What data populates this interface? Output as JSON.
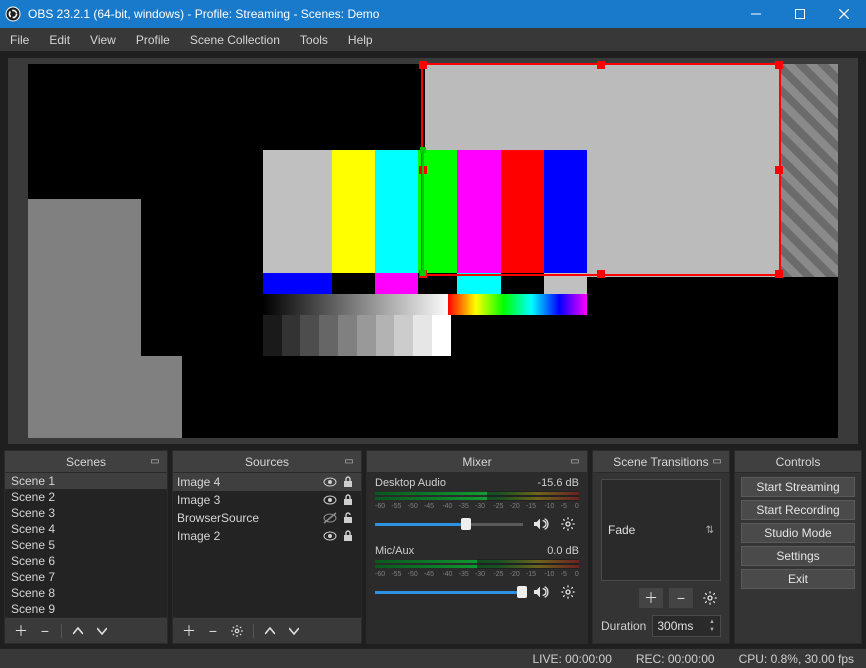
{
  "window": {
    "title": "OBS 23.2.1 (64-bit, windows) - Profile: Streaming - Scenes: Demo"
  },
  "menu": [
    "File",
    "Edit",
    "View",
    "Profile",
    "Scene Collection",
    "Tools",
    "Help"
  ],
  "scenes": {
    "title": "Scenes",
    "items": [
      "Scene 1",
      "Scene 2",
      "Scene 3",
      "Scene 4",
      "Scene 5",
      "Scene 6",
      "Scene 7",
      "Scene 8",
      "Scene 9"
    ],
    "selected": 0
  },
  "sources": {
    "title": "Sources",
    "items": [
      {
        "label": "Image 4",
        "visible": true,
        "locked": true
      },
      {
        "label": "Image 3",
        "visible": true,
        "locked": true
      },
      {
        "label": "BrowserSource",
        "visible": false,
        "locked": false
      },
      {
        "label": "Image 2",
        "visible": true,
        "locked": true
      }
    ],
    "selected": 0
  },
  "mixer": {
    "title": "Mixer",
    "channels": [
      {
        "name": "Desktop Audio",
        "db": "-15.6 dB",
        "ticks": [
          "-60",
          "-55",
          "-50",
          "-45",
          "-40",
          "-35",
          "-30",
          "-25",
          "-20",
          "-15",
          "-10",
          "-5",
          "0"
        ],
        "slider_pct": 58,
        "fill_off_pct": 45
      },
      {
        "name": "Mic/Aux",
        "db": "0.0 dB",
        "ticks": [
          "-60",
          "-55",
          "-50",
          "-45",
          "-40",
          "-35",
          "-30",
          "-25",
          "-20",
          "-15",
          "-10",
          "-5",
          "0"
        ],
        "slider_pct": 98,
        "fill_off_pct": 50
      }
    ]
  },
  "transitions": {
    "title": "Scene Transitions",
    "type": "Fade",
    "duration_label": "Duration",
    "duration_value": "300ms"
  },
  "controls": {
    "title": "Controls",
    "buttons": [
      "Start Streaming",
      "Start Recording",
      "Studio Mode",
      "Settings",
      "Exit"
    ]
  },
  "status": {
    "live": "LIVE: 00:00:00",
    "rec": "REC: 00:00:00",
    "cpu": "CPU: 0.8%, 30.00 fps"
  }
}
